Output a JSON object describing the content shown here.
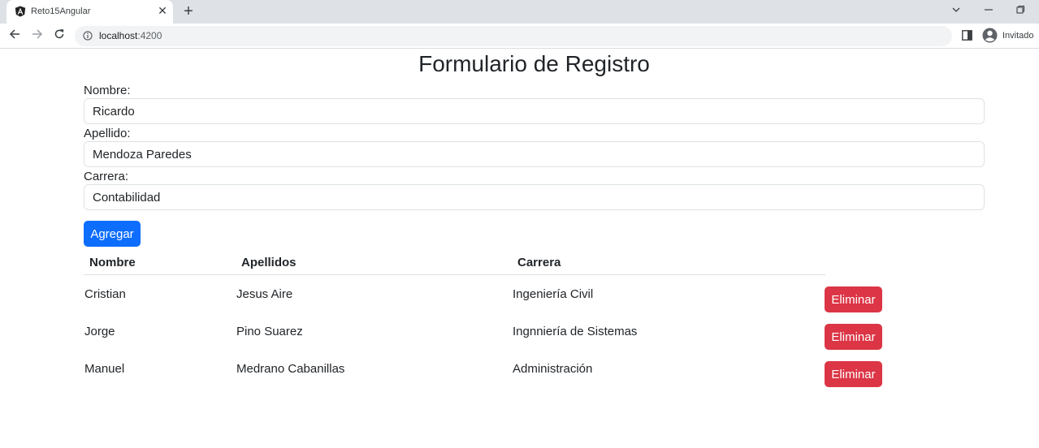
{
  "browser": {
    "tab_title": "Reto15Angular",
    "url_host": "localhost",
    "url_port": ":4200",
    "profile_label": "Invitado"
  },
  "page": {
    "title": "Formulario de Registro"
  },
  "form": {
    "nombre_label": "Nombre:",
    "nombre_value": "Ricardo",
    "apellido_label": "Apellido:",
    "apellido_value": "Mendoza Paredes",
    "carrera_label": "Carrera:",
    "carrera_value": "Contabilidad",
    "submit_label": "Agregar"
  },
  "table": {
    "headers": [
      "Nombre",
      "Apellidos",
      "Carrera"
    ],
    "rows": [
      {
        "nombre": "Cristian",
        "apellidos": "Jesus Aire",
        "carrera": "Ingeniería Civil",
        "action": "Eliminar"
      },
      {
        "nombre": "Jorge",
        "apellidos": "Pino Suarez",
        "carrera": "Ingnniería de Sistemas",
        "action": "Eliminar"
      },
      {
        "nombre": "Manuel",
        "apellidos": "Medrano Cabanillas",
        "carrera": "Administración",
        "action": "Eliminar"
      }
    ]
  },
  "colors": {
    "primary": "#0d6efd",
    "danger": "#dc3545"
  }
}
